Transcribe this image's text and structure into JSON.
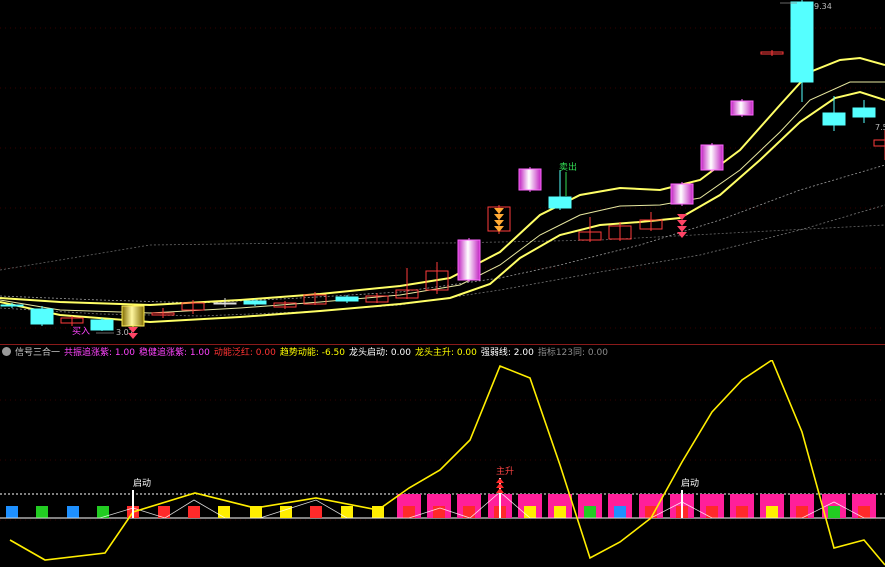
{
  "colors": {
    "background": "#000000",
    "bull_candle": "#ff3b3b",
    "bear_candle": "#55ffff",
    "channel_line": "#ffff66",
    "signal_line": "#ffff00",
    "magenta_bar": "#ff33cc",
    "pane_separator": "#8a1a1a"
  },
  "price_pane": {
    "labels": {
      "high_price": "9.34",
      "partial_right_price": "7.5",
      "low_price": "3.07",
      "buy_label": "买入",
      "sell_label": "卖出"
    }
  },
  "indicator_pane": {
    "title": "信号三合一",
    "fields": [
      {
        "label": "共振追涨紫:",
        "value": "1.00",
        "color": "#ff44ff"
      },
      {
        "label": "稳健追涨紫:",
        "value": "1.00",
        "color": "#ff44ff"
      },
      {
        "label": "动能泛红:",
        "value": "0.00",
        "color": "#ff3333"
      },
      {
        "label": "趋势动能:",
        "value": "-6.50",
        "color": "#ffff00"
      },
      {
        "label": "龙头启动:",
        "value": "0.00",
        "color": "#ffffff"
      },
      {
        "label": "龙头主升:",
        "value": "0.00",
        "color": "#ffff00"
      },
      {
        "label": "强弱线:",
        "value": "2.00",
        "color": "#ffffff"
      },
      {
        "label": "指标123同:",
        "value": "0.00",
        "color": "#8a8a8a"
      }
    ],
    "markers": {
      "start_label_1": "启动",
      "main_rise_label": "主升",
      "start_label_2": "启动"
    }
  }
}
